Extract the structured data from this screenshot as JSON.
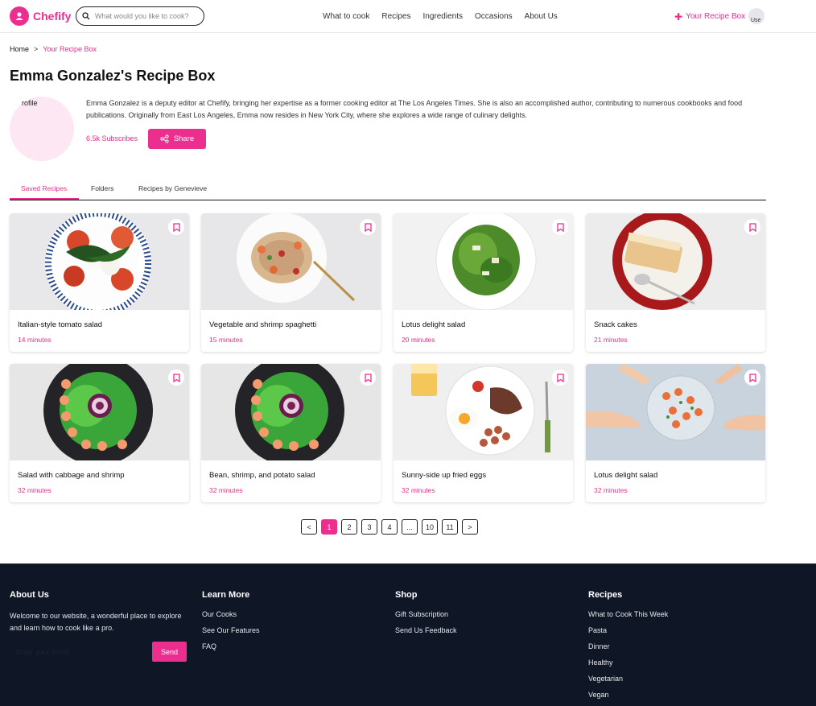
{
  "header": {
    "logo_text": "Chefify",
    "search_placeholder": "What would you like to cook?",
    "nav": [
      "What to cook",
      "Recipes",
      "Ingredients",
      "Occasions",
      "About Us"
    ],
    "recipe_box_label": "Your Recipe Box",
    "avatar_alt": "Use"
  },
  "breadcrumb": {
    "home": "Home",
    "separator": ">",
    "current": "Your Recipe Box"
  },
  "profile": {
    "title": "Emma Gonzalez's Recipe Box",
    "picture_alt": "rofile",
    "bio": "Emma Gonzalez is a deputy editor at Chefify, bringing her expertise as a former cooking editor at The Los Angeles Times. She is also an accomplished author, contributing to numerous cookbooks and food publications. Originally from East Los Angeles, Emma now resides in New York City, where she explores a wide range of culinary delights.",
    "subscribers": "6.5k Subscribes",
    "share_label": "Share"
  },
  "tabs": [
    "Saved Recipes",
    "Folders",
    "Recipes by Genevieve"
  ],
  "recipes": [
    {
      "title": "Italian-style tomato salad",
      "time": "14 minutes"
    },
    {
      "title": "Vegetable and shrimp spaghetti",
      "time": "15 minutes"
    },
    {
      "title": "Lotus delight salad",
      "time": "20 minutes"
    },
    {
      "title": "Snack cakes",
      "time": "21 minutes"
    },
    {
      "title": "Salad with cabbage and shrimp",
      "time": "32 minutes"
    },
    {
      "title": "Bean, shrimp, and potato salad",
      "time": "32 minutes"
    },
    {
      "title": "Sunny-side up fried eggs",
      "time": "32 minutes"
    },
    {
      "title": "Lotus delight salad",
      "time": "32 minutes"
    }
  ],
  "pagination": {
    "prev": "<",
    "pages": [
      "1",
      "2",
      "3",
      "4",
      "...",
      "10",
      "11"
    ],
    "next": ">",
    "current_page": 1
  },
  "footer": {
    "about": {
      "heading": "About Us",
      "text": "Welcome to our website, a wonderful place to explore and learn how to cook like a pro.",
      "email_placeholder": "Enter your email",
      "send_label": "Send"
    },
    "learn_more": {
      "heading": "Learn More",
      "links": [
        "Our Cooks",
        "See Our Features",
        "FAQ"
      ]
    },
    "shop": {
      "heading": "Shop",
      "links": [
        "Gift Subscription",
        "Send Us Feedback"
      ]
    },
    "recipes": {
      "heading": "Recipes",
      "links": [
        "What to Cook This Week",
        "Pasta",
        "Dinner",
        "Healthy",
        "Vegetarian",
        "Vegan"
      ]
    }
  },
  "colors": {
    "accent": "#ec2f8e",
    "footer_bg": "#0f1626",
    "profile_pic_bg": "#fce7f3"
  }
}
